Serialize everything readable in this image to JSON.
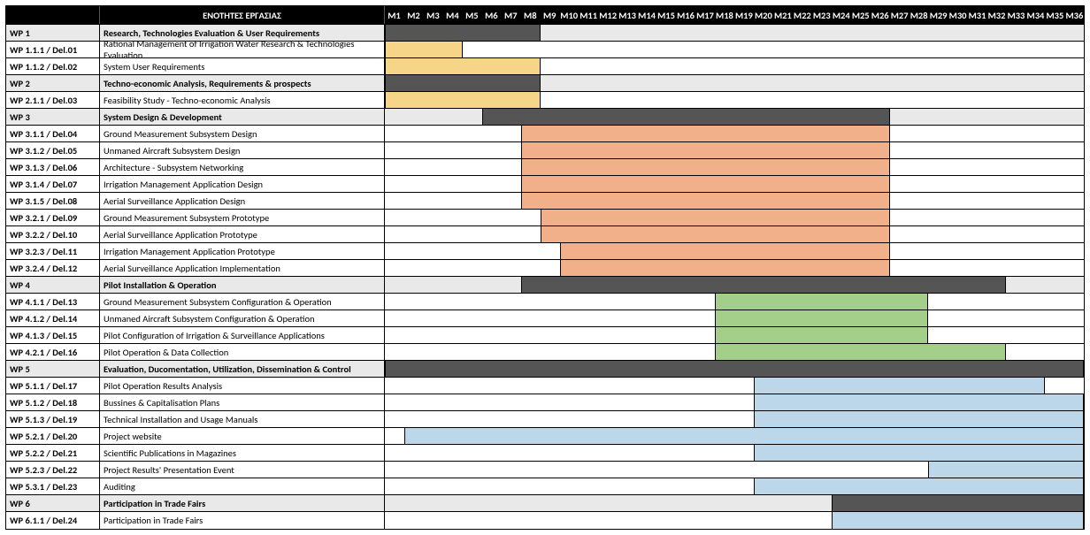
{
  "header": {
    "title": "ΕΝΟΤΗΤΕΣ ΕΡΓΑΣΙΑΣ"
  },
  "months": [
    "M1",
    "M2",
    "M3",
    "M4",
    "M5",
    "M6",
    "M7",
    "M8",
    "M9",
    "M10",
    "M11",
    "M12",
    "M13",
    "M14",
    "M15",
    "M16",
    "M17",
    "M18",
    "M19",
    "M20",
    "M21",
    "M22",
    "M23",
    "M24",
    "M25",
    "M26",
    "M27",
    "M28",
    "M29",
    "M30",
    "M31",
    "M32",
    "M33",
    "M34",
    "M35",
    "M36"
  ],
  "rows": [
    {
      "type": "wp",
      "id": "WP 1",
      "name": "Research, Technologies Evaluation & User Requirements",
      "bar": {
        "start": 1,
        "end": 8,
        "color": "dark"
      }
    },
    {
      "type": "task",
      "id": "WP 1.1.1 / Del.01",
      "name": "Rational Management of Irrigation Water Research & Technologies Evaluation",
      "bar": {
        "start": 1,
        "end": 4,
        "color": "yellow"
      }
    },
    {
      "type": "task",
      "id": "WP 1.1.2 / Del.02",
      "name": "System User Requirements",
      "bar": {
        "start": 1,
        "end": 8,
        "color": "yellow"
      }
    },
    {
      "type": "wp",
      "id": "WP 2",
      "name": "Techno-economic Analysis, Requirements & prospects",
      "bar": {
        "start": 1,
        "end": 8,
        "color": "dark"
      }
    },
    {
      "type": "task",
      "id": "WP 2.1.1 / Del.03",
      "name": "Feasibility Study - Techno-economic Analysis",
      "bar": {
        "start": 1,
        "end": 8,
        "color": "yellow"
      }
    },
    {
      "type": "wp",
      "id": "WP 3",
      "name": "System Design & Development",
      "bar": {
        "start": 6,
        "end": 26,
        "color": "dark"
      }
    },
    {
      "type": "task",
      "id": "WP 3.1.1 / Del.04",
      "name": "Ground Measurement Subsystem Design",
      "bar": {
        "start": 8,
        "end": 26,
        "color": "orange"
      }
    },
    {
      "type": "task",
      "id": "WP 3.1.2 / Del.05",
      "name": "Unmaned Aircraft Subsystem Design",
      "bar": {
        "start": 8,
        "end": 26,
        "color": "orange"
      }
    },
    {
      "type": "task",
      "id": "WP 3.1.3 / Del.06",
      "name": "Architecture - Subsystem Networking",
      "bar": {
        "start": 8,
        "end": 26,
        "color": "orange"
      }
    },
    {
      "type": "task",
      "id": "WP 3.1.4 / Del.07",
      "name": "Irrigation Management Application Design",
      "bar": {
        "start": 8,
        "end": 26,
        "color": "orange"
      }
    },
    {
      "type": "task",
      "id": "WP 3.1.5 / Del.08",
      "name": "Aerial Surveillance Application Design",
      "bar": {
        "start": 8,
        "end": 26,
        "color": "orange"
      }
    },
    {
      "type": "task",
      "id": "WP 3.2.1 / Del.09",
      "name": "Ground Measurement Subsystem Prototype",
      "bar": {
        "start": 9,
        "end": 26,
        "color": "orange"
      }
    },
    {
      "type": "task",
      "id": "WP 3.2.2 / Del.10",
      "name": "Aerial Surveillance Application Prototype",
      "bar": {
        "start": 9,
        "end": 26,
        "color": "orange"
      }
    },
    {
      "type": "task",
      "id": "WP 3.2.3 / Del.11",
      "name": "Irrigation Management Application Prototype",
      "bar": {
        "start": 10,
        "end": 26,
        "color": "orange"
      }
    },
    {
      "type": "task",
      "id": "WP 3.2.4 / Del.12",
      "name": "Aerial Surveillance Application Implementation",
      "bar": {
        "start": 10,
        "end": 26,
        "color": "orange"
      }
    },
    {
      "type": "wp",
      "id": "WP 4",
      "name": "Pilot Installation & Operation",
      "bar": {
        "start": 8,
        "end": 32,
        "color": "dark"
      }
    },
    {
      "type": "task",
      "id": "WP 4.1.1 / Del.13",
      "name": "Ground Measurement Subsystem Configuration & Operation",
      "bar": {
        "start": 18,
        "end": 28,
        "color": "green"
      }
    },
    {
      "type": "task",
      "id": "WP 4.1.2 / Del.14",
      "name": "Unmaned Aircraft Subsystem Configuration & Operation",
      "bar": {
        "start": 18,
        "end": 28,
        "color": "green"
      }
    },
    {
      "type": "task",
      "id": "WP 4.1.3 / Del.15",
      "name": "Pilot Configuration of Irrigation & Surveillance Applications",
      "bar": {
        "start": 18,
        "end": 28,
        "color": "green"
      }
    },
    {
      "type": "task",
      "id": "WP 4.2.1 / Del.16",
      "name": "Pilot Operation & Data Collection",
      "bar": {
        "start": 18,
        "end": 32,
        "color": "green"
      }
    },
    {
      "type": "wp",
      "id": "WP 5",
      "name": "Evaluation, Ducomentation, Utilization, Dissemination & Control",
      "bar": {
        "start": 1,
        "end": 36,
        "color": "dark"
      }
    },
    {
      "type": "task",
      "id": "WP 5.1.1 / Del.17",
      "name": "Pilot Operation Results Analysis",
      "bar": {
        "start": 20,
        "end": 34,
        "color": "blue"
      }
    },
    {
      "type": "task",
      "id": "WP 5.1.2 / Del.18",
      "name": "Bussines & Capitalisation Plans",
      "bar": {
        "start": 20,
        "end": 36,
        "color": "blue"
      }
    },
    {
      "type": "task",
      "id": "WP 5.1.3 / Del.19",
      "name": "Technical Installation and Usage Manuals",
      "bar": {
        "start": 20,
        "end": 36,
        "color": "blue"
      }
    },
    {
      "type": "task",
      "id": "WP 5.2.1 / Del.20",
      "name": "Project website",
      "bar": {
        "start": 2,
        "end": 36,
        "color": "blue"
      }
    },
    {
      "type": "task",
      "id": "WP 5.2.2 / Del.21",
      "name": "Scientific Publications in Magazines",
      "bar": {
        "start": 20,
        "end": 36,
        "color": "blue"
      }
    },
    {
      "type": "task",
      "id": "WP 5.2.3 / Del.22",
      "name": "Project Results' Presentation Event",
      "bar": {
        "start": 29,
        "end": 36,
        "color": "blue"
      }
    },
    {
      "type": "task",
      "id": "WP 5.3.1 / Del.23",
      "name": "Auditing",
      "bar": {
        "start": 20,
        "end": 36,
        "color": "blue"
      }
    },
    {
      "type": "wp",
      "id": "WP 6",
      "name": "Participation in Trade Fairs",
      "bar": {
        "start": 24,
        "end": 36,
        "color": "dark"
      }
    },
    {
      "type": "task",
      "id": "WP 6.1.1 / Del.24",
      "name": "Participation in Trade Fairs",
      "bar": {
        "start": 24,
        "end": 36,
        "color": "blue"
      }
    }
  ],
  "colors": {
    "dark": "#555",
    "yellow": "#f6d588",
    "orange": "#f1b08a",
    "green": "#a4cf8b",
    "blue": "#bcd7ea"
  },
  "chart_data": {
    "type": "gantt",
    "title": "ΕΝΟΤΗΤΕΣ ΕΡΓΑΣΙΑΣ",
    "x_unit": "month",
    "x_range": [
      1,
      36
    ],
    "tasks": [
      {
        "id": "WP 1",
        "name": "Research, Technologies Evaluation & User Requirements",
        "start": 1,
        "end": 8,
        "group": true
      },
      {
        "id": "WP 1.1.1 / Del.01",
        "name": "Rational Management of Irrigation Water Research & Technologies Evaluation",
        "start": 1,
        "end": 4
      },
      {
        "id": "WP 1.1.2 / Del.02",
        "name": "System User Requirements",
        "start": 1,
        "end": 8
      },
      {
        "id": "WP 2",
        "name": "Techno-economic Analysis, Requirements & prospects",
        "start": 1,
        "end": 8,
        "group": true
      },
      {
        "id": "WP 2.1.1 / Del.03",
        "name": "Feasibility Study - Techno-economic Analysis",
        "start": 1,
        "end": 8
      },
      {
        "id": "WP 3",
        "name": "System Design & Development",
        "start": 6,
        "end": 26,
        "group": true
      },
      {
        "id": "WP 3.1.1 / Del.04",
        "name": "Ground Measurement Subsystem Design",
        "start": 8,
        "end": 26
      },
      {
        "id": "WP 3.1.2 / Del.05",
        "name": "Unmaned Aircraft Subsystem Design",
        "start": 8,
        "end": 26
      },
      {
        "id": "WP 3.1.3 / Del.06",
        "name": "Architecture - Subsystem Networking",
        "start": 8,
        "end": 26
      },
      {
        "id": "WP 3.1.4 / Del.07",
        "name": "Irrigation Management Application Design",
        "start": 8,
        "end": 26
      },
      {
        "id": "WP 3.1.5 / Del.08",
        "name": "Aerial Surveillance Application Design",
        "start": 8,
        "end": 26
      },
      {
        "id": "WP 3.2.1 / Del.09",
        "name": "Ground Measurement Subsystem Prototype",
        "start": 9,
        "end": 26
      },
      {
        "id": "WP 3.2.2 / Del.10",
        "name": "Aerial Surveillance Application Prototype",
        "start": 9,
        "end": 26
      },
      {
        "id": "WP 3.2.3 / Del.11",
        "name": "Irrigation Management Application Prototype",
        "start": 10,
        "end": 26
      },
      {
        "id": "WP 3.2.4 / Del.12",
        "name": "Aerial Surveillance Application Implementation",
        "start": 10,
        "end": 26
      },
      {
        "id": "WP 4",
        "name": "Pilot Installation & Operation",
        "start": 8,
        "end": 32,
        "group": true
      },
      {
        "id": "WP 4.1.1 / Del.13",
        "name": "Ground Measurement Subsystem Configuration & Operation",
        "start": 18,
        "end": 28
      },
      {
        "id": "WP 4.1.2 / Del.14",
        "name": "Unmaned Aircraft Subsystem Configuration & Operation",
        "start": 18,
        "end": 28
      },
      {
        "id": "WP 4.1.3 / Del.15",
        "name": "Pilot Configuration of Irrigation & Surveillance Applications",
        "start": 18,
        "end": 28
      },
      {
        "id": "WP 4.2.1 / Del.16",
        "name": "Pilot Operation & Data Collection",
        "start": 18,
        "end": 32
      },
      {
        "id": "WP 5",
        "name": "Evaluation, Ducomentation, Utilization, Dissemination & Control",
        "start": 1,
        "end": 36,
        "group": true
      },
      {
        "id": "WP 5.1.1 / Del.17",
        "name": "Pilot Operation Results Analysis",
        "start": 20,
        "end": 34
      },
      {
        "id": "WP 5.1.2 / Del.18",
        "name": "Bussines & Capitalisation Plans",
        "start": 20,
        "end": 36
      },
      {
        "id": "WP 5.1.3 / Del.19",
        "name": "Technical Installation and Usage Manuals",
        "start": 20,
        "end": 36
      },
      {
        "id": "WP 5.2.1 / Del.20",
        "name": "Project website",
        "start": 2,
        "end": 36
      },
      {
        "id": "WP 5.2.2 / Del.21",
        "name": "Scientific Publications in Magazines",
        "start": 20,
        "end": 36
      },
      {
        "id": "WP 5.2.3 / Del.22",
        "name": "Project Results' Presentation Event",
        "start": 29,
        "end": 36
      },
      {
        "id": "WP 5.3.1 / Del.23",
        "name": "Auditing",
        "start": 20,
        "end": 36
      },
      {
        "id": "WP 6",
        "name": "Participation in Trade Fairs",
        "start": 24,
        "end": 36,
        "group": true
      },
      {
        "id": "WP 6.1.1 / Del.24",
        "name": "Participation in Trade Fairs",
        "start": 24,
        "end": 36
      }
    ]
  }
}
